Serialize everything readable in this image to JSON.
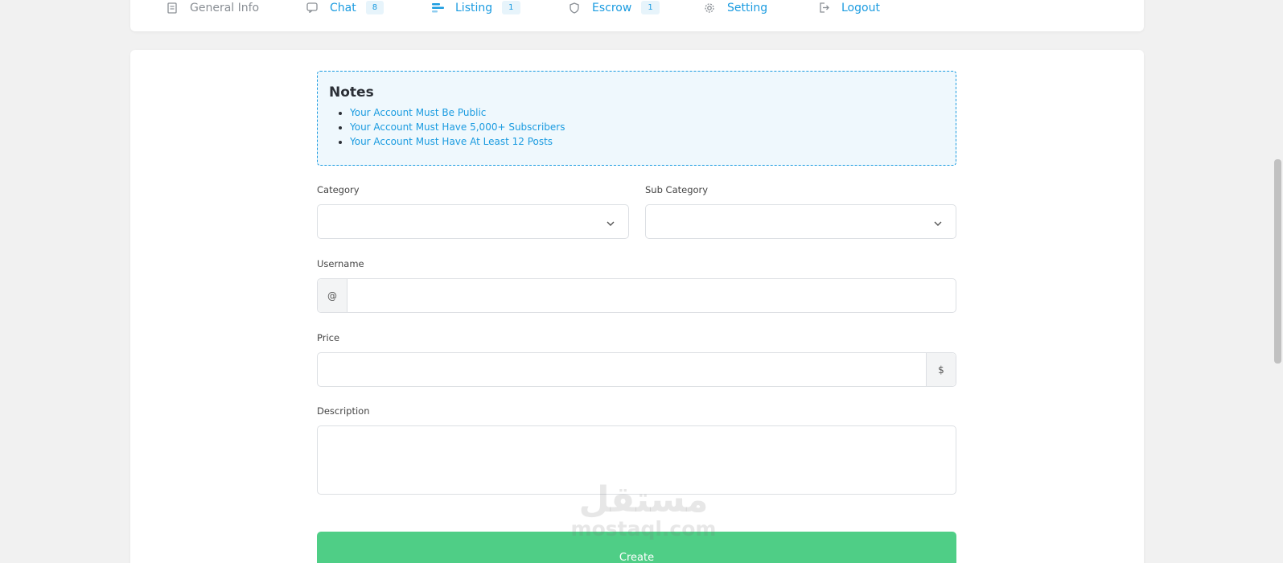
{
  "nav": {
    "items": [
      {
        "label": "General Info",
        "icon": "document-icon"
      },
      {
        "label": "Chat",
        "badge": "8",
        "icon": "chat-icon"
      },
      {
        "label": "Listing",
        "badge": "1",
        "icon": "list-icon"
      },
      {
        "label": "Escrow",
        "badge": "1",
        "icon": "shield-icon"
      },
      {
        "label": "Setting",
        "icon": "gear-icon"
      },
      {
        "label": "Logout",
        "icon": "logout-icon"
      }
    ]
  },
  "notes": {
    "title": "Notes",
    "items": [
      "Your Account Must Be Public",
      "Your Account Must Have 5,000+ Subscribers",
      "Your Account Must Have At Least 12 Posts"
    ]
  },
  "form": {
    "category_label": "Category",
    "category_value": "",
    "subcategory_label": "Sub Category",
    "subcategory_value": "",
    "username_label": "Username",
    "username_prefix": "@",
    "username_value": "",
    "price_label": "Price",
    "price_suffix": "$",
    "price_value": "",
    "description_label": "Description",
    "description_value": "",
    "create_label": "Create"
  },
  "watermark": {
    "arabic": "مستقل",
    "latin": "mostaql.com"
  },
  "colors": {
    "accent": "#1a9be0",
    "create_button": "#4fce86",
    "notes_background": "#eff8fd"
  }
}
